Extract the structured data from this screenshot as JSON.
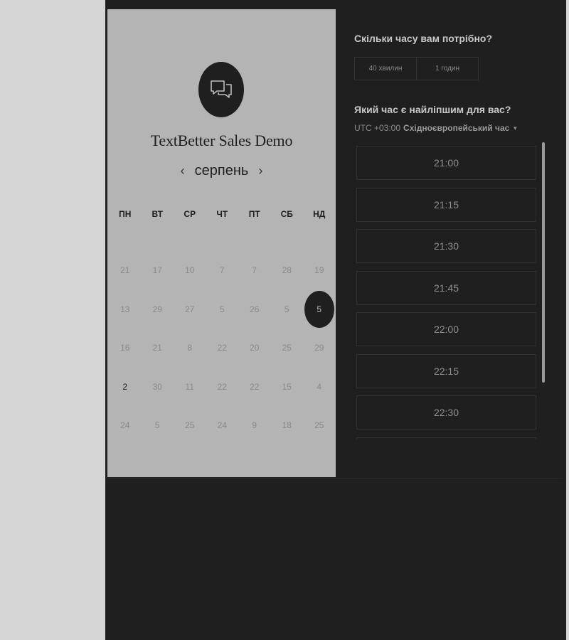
{
  "calendar": {
    "app_title": "TextBetter Sales Demo",
    "month": "серпень",
    "prev_icon": "‹",
    "next_icon": "›",
    "weekdays": [
      "ПН",
      "ВТ",
      "СР",
      "ЧТ",
      "ПТ",
      "СБ",
      "НД"
    ],
    "days": [
      "21",
      "17",
      "10",
      "7",
      "7",
      "28",
      "19",
      "13",
      "29",
      "27",
      "5",
      "26",
      "5",
      "5",
      "16",
      "21",
      "8",
      "22",
      "20",
      "25",
      "29",
      "2",
      "30",
      "11",
      "22",
      "22",
      "15",
      "4",
      "24",
      "5",
      "25",
      "24",
      "9",
      "18",
      "25"
    ],
    "selected_day": "5",
    "highlighted_day": "2"
  },
  "booking": {
    "duration_heading": "Скільки часу вам потрібно?",
    "durations": [
      "40 хвилин",
      "1 годин"
    ],
    "time_heading": "Який час є найліпшим для вас?",
    "timezone_offset": "UTC +03:00",
    "timezone_name": "Східноєвропейський час",
    "timezone_caret": "▼",
    "slots": [
      "21:00",
      "21:15",
      "21:30",
      "21:45",
      "22:00",
      "22:15",
      "22:30",
      ""
    ]
  },
  "colors": {
    "backdrop": "#d6d6d6",
    "modal": "#1f1f1f",
    "calendar_panel": "#b4b4b4"
  }
}
